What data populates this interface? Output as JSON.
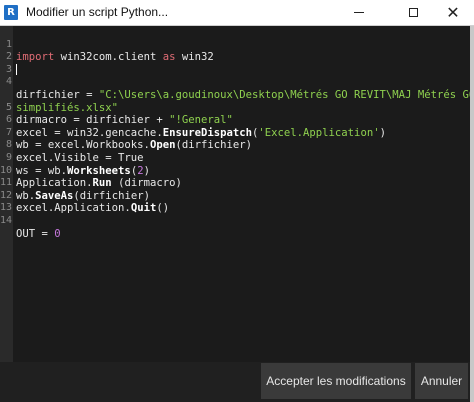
{
  "window": {
    "app_icon_letter": "R",
    "title": "Modifier un script Python...",
    "minimize_glyph": "",
    "close_glyph": "✕"
  },
  "code": {
    "lines": [
      {
        "n": "1",
        "text": "import win32com.client as win32"
      },
      {
        "n": "2",
        "text": ""
      },
      {
        "n": "3",
        "text": ""
      },
      {
        "n": "4",
        "text": "dirfichier = \"C:\\Users\\a.goudinoux\\Desktop\\Métrés GO REVIT\\MAJ Métrés GO"
      },
      {
        "n": "",
        "text": "simplifiés.xlsx\""
      },
      {
        "n": "5",
        "text": "dirmacro = dirfichier + \"!General\""
      },
      {
        "n": "6",
        "text": "excel = win32.gencache.EnsureDispatch('Excel.Application')"
      },
      {
        "n": "7",
        "text": "wb = excel.Workbooks.Open(dirfichier)"
      },
      {
        "n": "8",
        "text": "excel.Visible = True"
      },
      {
        "n": "9",
        "text": "ws = wb.Worksheets(2)"
      },
      {
        "n": "10",
        "text": "Application.Run (dirmacro)"
      },
      {
        "n": "11",
        "text": "wb.SaveAs(dirfichier)"
      },
      {
        "n": "12",
        "text": "excel.Application.Quit()"
      },
      {
        "n": "13",
        "text": ""
      },
      {
        "n": "14",
        "text": "OUT = 0"
      }
    ]
  },
  "footer": {
    "accept_label": "Accepter les modifications",
    "cancel_label": "Annuler"
  },
  "colors": {
    "editor_bg": "#1b1b1b",
    "keyword": "#e06c75",
    "string": "#8fd14f",
    "number": "#c678dd",
    "button_bg": "#3a3a3a"
  }
}
